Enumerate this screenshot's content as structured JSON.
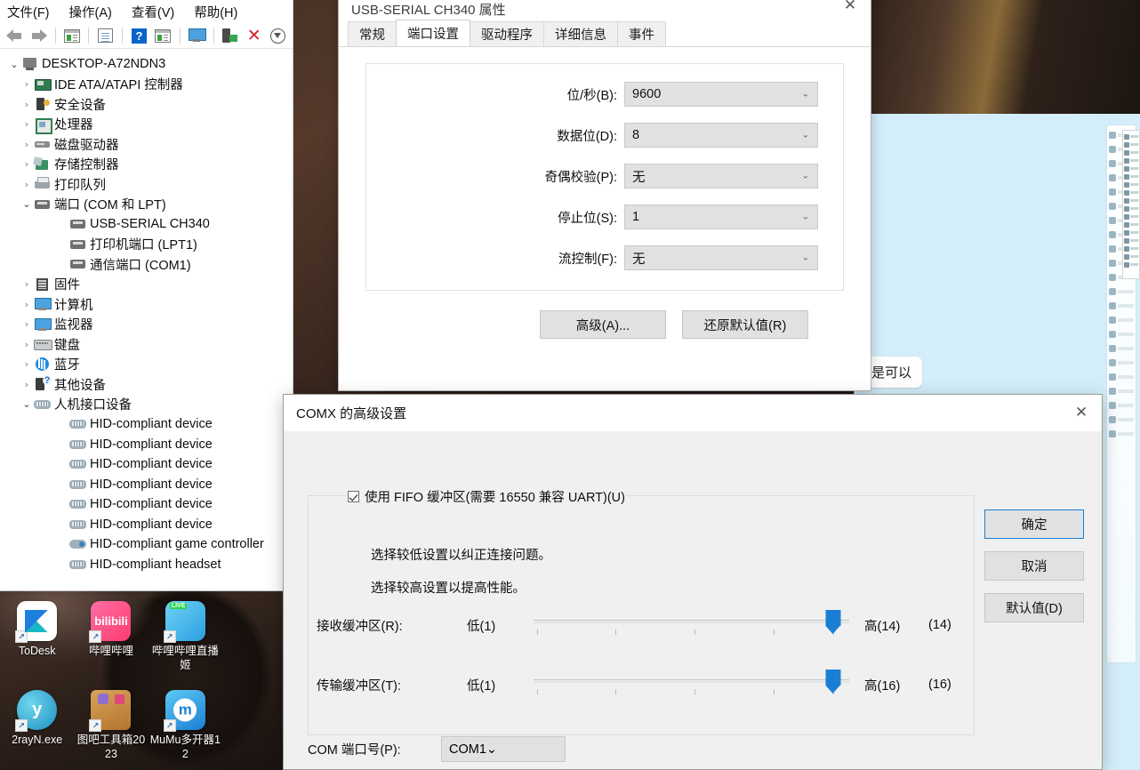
{
  "device_manager": {
    "menu": [
      {
        "label": "文件(F)",
        "name": "menu-file"
      },
      {
        "label": "操作(A)",
        "name": "menu-action"
      },
      {
        "label": "查看(V)",
        "name": "menu-view"
      },
      {
        "label": "帮助(H)",
        "name": "menu-help"
      }
    ],
    "toolbar": [
      {
        "icon": "back-arrow-icon"
      },
      {
        "icon": "forward-arrow-icon"
      },
      {
        "icon": "show-hidden-window-icon"
      },
      {
        "icon": "properties-icon"
      },
      {
        "icon": "help-icon"
      },
      {
        "icon": "scan-window-icon"
      },
      {
        "icon": "scan-hardware-icon"
      },
      {
        "icon": "update-driver-icon"
      },
      {
        "icon": "uninstall-device-icon"
      },
      {
        "icon": "download-icon"
      }
    ],
    "tree": [
      {
        "label": "DESKTOP-A72NDN3",
        "level": 0,
        "chevron": "open",
        "icon": "i-pc",
        "name": "tree-node-computer"
      },
      {
        "label": "IDE ATA/ATAPI 控制器",
        "level": 1,
        "chevron": "closed",
        "icon": "i-ide",
        "name": "tree-node-ide"
      },
      {
        "label": "安全设备",
        "level": 1,
        "chevron": "closed",
        "icon": "i-sec",
        "name": "tree-node-security"
      },
      {
        "label": "处理器",
        "level": 1,
        "chevron": "closed",
        "icon": "i-cpu",
        "name": "tree-node-processor"
      },
      {
        "label": "磁盘驱动器",
        "level": 1,
        "chevron": "closed",
        "icon": "i-disk",
        "name": "tree-node-disk"
      },
      {
        "label": "存储控制器",
        "level": 1,
        "chevron": "closed",
        "icon": "i-store",
        "name": "tree-node-storage"
      },
      {
        "label": "打印队列",
        "level": 1,
        "chevron": "closed",
        "icon": "i-print",
        "name": "tree-node-print-queue"
      },
      {
        "label": "端口 (COM 和 LPT)",
        "level": 1,
        "chevron": "open",
        "icon": "i-port",
        "name": "tree-node-ports"
      },
      {
        "label": "USB-SERIAL CH340",
        "level": 2,
        "chevron": "none",
        "icon": "i-port",
        "name": "tree-node-usb-serial-ch340"
      },
      {
        "label": "打印机端口 (LPT1)",
        "level": 2,
        "chevron": "none",
        "icon": "i-port",
        "name": "tree-node-printer-port-lpt1"
      },
      {
        "label": "通信端口 (COM1)",
        "level": 2,
        "chevron": "none",
        "icon": "i-port",
        "name": "tree-node-comm-port-com1"
      },
      {
        "label": "固件",
        "level": 1,
        "chevron": "closed",
        "icon": "i-fw",
        "name": "tree-node-firmware"
      },
      {
        "label": "计算机",
        "level": 1,
        "chevron": "closed",
        "icon": "i-mon",
        "name": "tree-node-computer-sub"
      },
      {
        "label": "监视器",
        "level": 1,
        "chevron": "closed",
        "icon": "i-mon",
        "name": "tree-node-monitor"
      },
      {
        "label": "键盘",
        "level": 1,
        "chevron": "closed",
        "icon": "i-kb",
        "name": "tree-node-keyboard"
      },
      {
        "label": "蓝牙",
        "level": 1,
        "chevron": "closed",
        "icon": "i-bt",
        "name": "tree-node-bluetooth"
      },
      {
        "label": "其他设备",
        "level": 1,
        "chevron": "closed",
        "icon": "i-other",
        "name": "tree-node-other-devices"
      },
      {
        "label": "人机接口设备",
        "level": 1,
        "chevron": "open",
        "icon": "i-hid",
        "name": "tree-node-hid"
      },
      {
        "label": "HID-compliant device",
        "level": 2,
        "chevron": "none",
        "icon": "i-hid",
        "name": "tree-node-hid-device"
      },
      {
        "label": "HID-compliant device",
        "level": 2,
        "chevron": "none",
        "icon": "i-hid",
        "name": "tree-node-hid-device"
      },
      {
        "label": "HID-compliant device",
        "level": 2,
        "chevron": "none",
        "icon": "i-hid",
        "name": "tree-node-hid-device"
      },
      {
        "label": "HID-compliant device",
        "level": 2,
        "chevron": "none",
        "icon": "i-hid",
        "name": "tree-node-hid-device"
      },
      {
        "label": "HID-compliant device",
        "level": 2,
        "chevron": "none",
        "icon": "i-hid",
        "name": "tree-node-hid-device"
      },
      {
        "label": "HID-compliant device",
        "level": 2,
        "chevron": "none",
        "icon": "i-hid",
        "name": "tree-node-hid-device"
      },
      {
        "label": "HID-compliant game controller",
        "level": 2,
        "chevron": "none",
        "icon": "i-gamepad",
        "name": "tree-node-hid-game-controller"
      },
      {
        "label": "HID-compliant headset",
        "level": 2,
        "chevron": "none",
        "icon": "i-hid",
        "name": "tree-node-hid-headset"
      }
    ]
  },
  "properties_dialog": {
    "title": "USB-SERIAL CH340 属性",
    "close_label": "✕",
    "tabs": [
      {
        "label": "常规",
        "active": false
      },
      {
        "label": "端口设置",
        "active": true
      },
      {
        "label": "驱动程序",
        "active": false
      },
      {
        "label": "详细信息",
        "active": false
      },
      {
        "label": "事件",
        "active": false
      }
    ],
    "fields": [
      {
        "label": "位/秒(B):",
        "value": "9600",
        "name": "bits-per-second-combo"
      },
      {
        "label": "数据位(D):",
        "value": "8",
        "name": "data-bits-combo"
      },
      {
        "label": "奇偶校验(P):",
        "value": "无",
        "name": "parity-combo"
      },
      {
        "label": "停止位(S):",
        "value": "1",
        "name": "stop-bits-combo"
      },
      {
        "label": "流控制(F):",
        "value": "无",
        "name": "flow-control-combo"
      }
    ],
    "buttons": [
      {
        "label": "高级(A)...",
        "name": "advanced-button"
      },
      {
        "label": "还原默认值(R)",
        "name": "restore-defaults-button"
      }
    ]
  },
  "advanced_dialog": {
    "title": "COMX 的高级设置",
    "close_label": "✕",
    "fifo_checkbox": {
      "label": "使用 FIFO 缓冲区(需要 16550 兼容 UART)(U)",
      "checked": true
    },
    "description_1": "选择较低设置以纠正连接问题。",
    "description_2": "选择较高设置以提高性能。",
    "sliders": [
      {
        "label": "接收缓冲区(R):",
        "low": "低(1)",
        "high": "高(14)",
        "value": "(14)",
        "percent": 95,
        "name": "receive-buffer-slider"
      },
      {
        "label": "传输缓冲区(T):",
        "low": "低(1)",
        "high": "高(16)",
        "value": "(16)",
        "percent": 95,
        "name": "transmit-buffer-slider"
      }
    ],
    "buttons": [
      {
        "label": "确定",
        "name": "ok-button",
        "default": true
      },
      {
        "label": "取消",
        "name": "cancel-button",
        "default": false
      },
      {
        "label": "默认值(D)",
        "name": "defaults-button",
        "default": false
      }
    ],
    "com_port": {
      "label": "COM 端口号(P):",
      "value": "COM1"
    }
  },
  "background": {
    "chat_bubble_text": "是可以"
  },
  "desktop_icons": [
    {
      "label": "ToDesk",
      "glyph_class": "g-todesk",
      "glyph_text": "",
      "name": "desktop-icon-todesk"
    },
    {
      "label": "哔哩哔哩",
      "glyph_class": "g-bili",
      "glyph_text": "bilibili",
      "name": "desktop-icon-bilibili"
    },
    {
      "label": "哔哩哔哩直播姬",
      "glyph_class": "g-bililive",
      "glyph_text": "",
      "name": "desktop-icon-bilibili-live"
    },
    {
      "label": "2rayN.exe",
      "glyph_class": "g-v2ray",
      "glyph_text": "y",
      "name": "desktop-icon-v2rayn"
    },
    {
      "label": "图吧工具箱2023",
      "glyph_class": "g-tuba",
      "glyph_text": "",
      "name": "desktop-icon-tuba-toolbox"
    },
    {
      "label": "MuMu多开器12",
      "glyph_class": "g-mumu",
      "glyph_text": "",
      "name": "desktop-icon-mumu"
    }
  ],
  "colors": {
    "accent_blue": "#1a7fd4",
    "dialog_bg": "#f0f0f0",
    "combo_bg": "#e1e1e1",
    "bg_app_blue": "#d3eefa"
  }
}
